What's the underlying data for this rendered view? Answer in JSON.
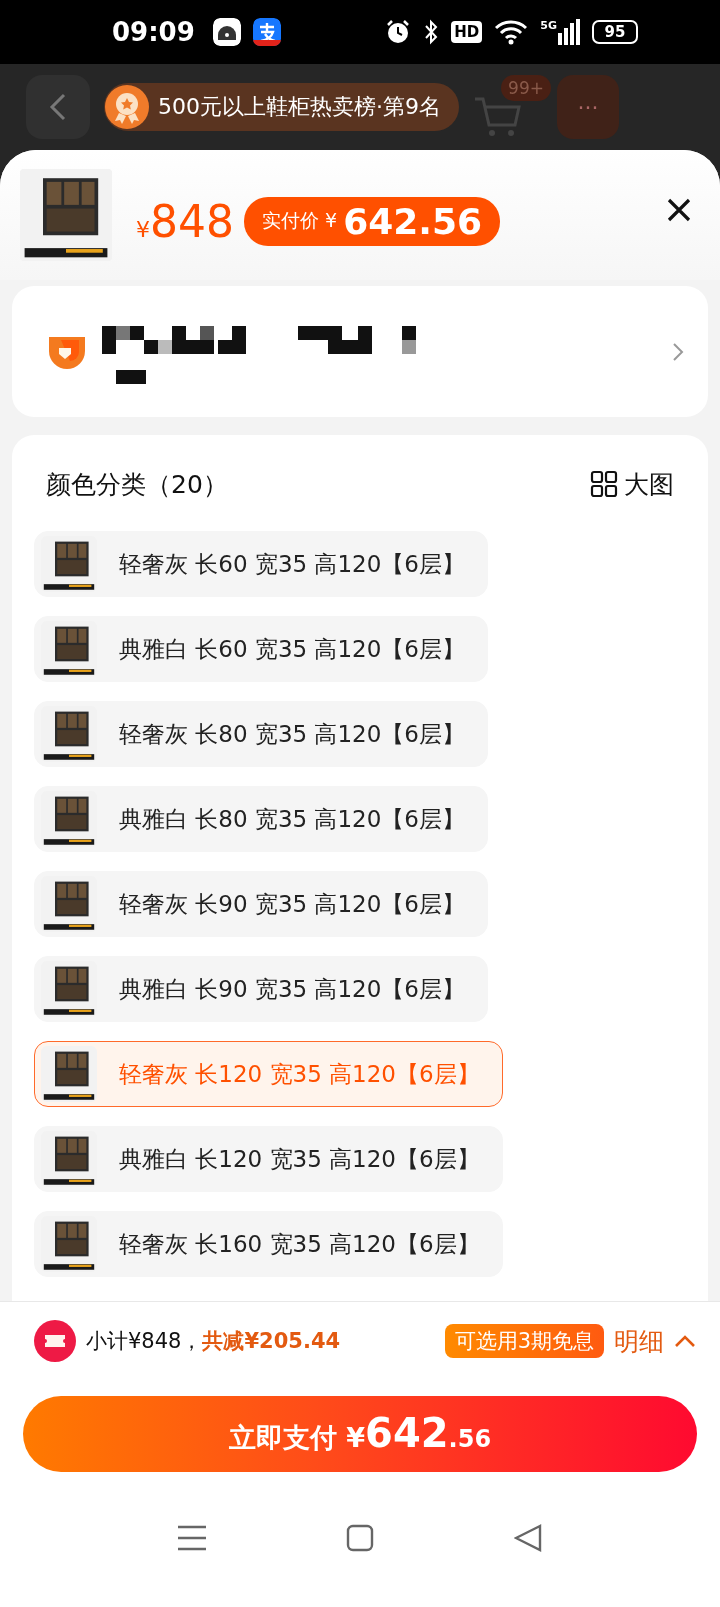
{
  "status_bar": {
    "time": "09:09",
    "network": "5G",
    "hd": "HD",
    "battery": "95"
  },
  "header": {
    "rank_banner": "500元以上鞋柜热卖榜·第9名",
    "cart_badge": "99+",
    "more": "···"
  },
  "price": {
    "symbol": "¥",
    "original": "848",
    "final_label": "实付价 ¥",
    "final": "642.56"
  },
  "options": {
    "title": "颜色分类（20）",
    "view_toggle": "大图",
    "items": [
      {
        "label": "轻奢灰 长60 宽35 高120【6层】",
        "selected": false
      },
      {
        "label": "典雅白 长60 宽35 高120【6层】",
        "selected": false
      },
      {
        "label": "轻奢灰 长80 宽35 高120【6层】",
        "selected": false
      },
      {
        "label": "典雅白 长80 宽35 高120【6层】",
        "selected": false
      },
      {
        "label": "轻奢灰 长90 宽35 高120【6层】",
        "selected": false
      },
      {
        "label": "典雅白 长90 宽35 高120【6层】",
        "selected": false
      },
      {
        "label": "轻奢灰 长120 宽35 高120【6层】",
        "selected": true
      },
      {
        "label": "典雅白 长120 宽35 高120【6层】",
        "selected": false
      },
      {
        "label": "轻奢灰 长160 宽35 高120【6层】",
        "selected": false
      }
    ]
  },
  "summary": {
    "subtotal": "小计¥848，",
    "discount": "共减¥205.44",
    "installment": "可选用3期免息",
    "details": "明细"
  },
  "pay_button": {
    "label": "立即支付 ¥",
    "amount": "642",
    "decimals": ".56"
  }
}
